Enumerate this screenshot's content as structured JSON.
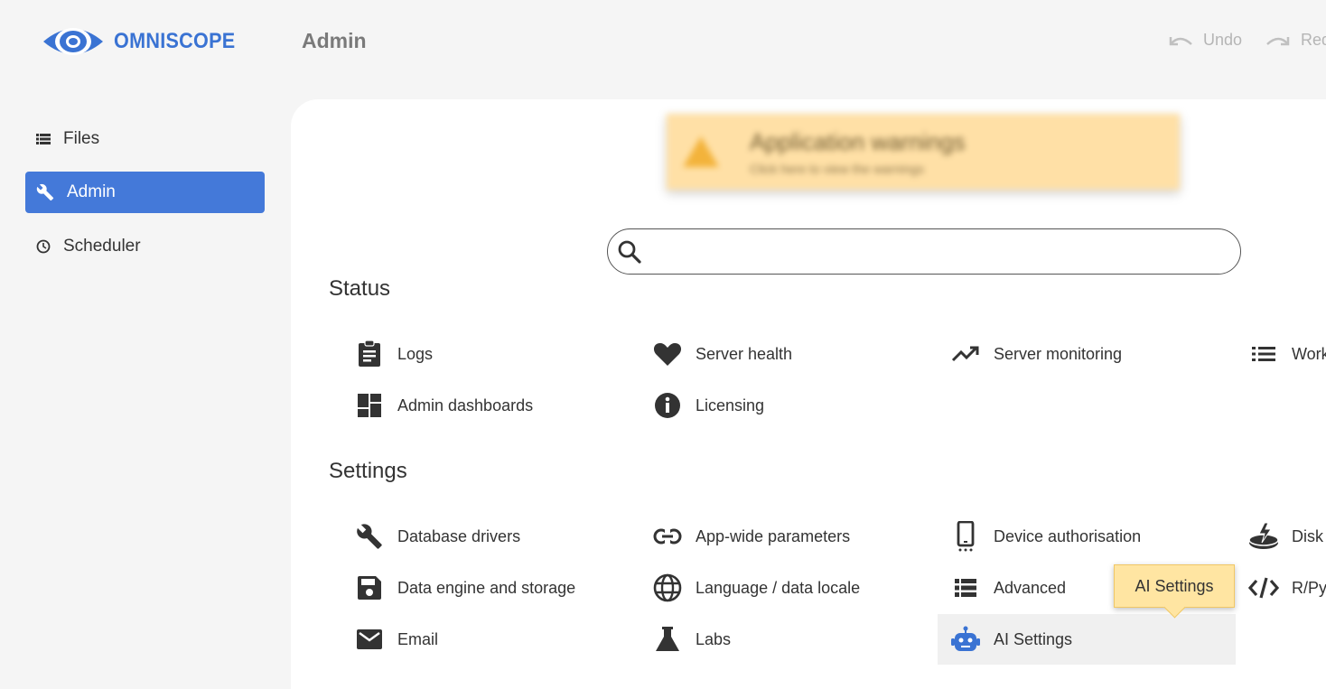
{
  "app": {
    "logo_text": "OMNISCOPE",
    "page_title": "Admin",
    "brand_color": "#3a73d3"
  },
  "history": {
    "undo_label": "Undo",
    "redo_label": "Redo"
  },
  "sidebar": {
    "items": [
      {
        "label": "Files",
        "icon": "list-icon"
      },
      {
        "label": "Admin",
        "icon": "wrench-icon",
        "active": true
      },
      {
        "label": "Scheduler",
        "icon": "clock-icon"
      }
    ]
  },
  "warning": {
    "title": "Application warnings",
    "subtitle": "Click here to view the warnings"
  },
  "search": {
    "placeholder": ""
  },
  "status": {
    "title": "Status",
    "items": [
      {
        "label": "Logs",
        "icon": "clipboard-icon"
      },
      {
        "label": "Server health",
        "icon": "heart-icon"
      },
      {
        "label": "Server monitoring",
        "icon": "trending-up-icon"
      },
      {
        "label": "Work",
        "icon": "list-lines-icon"
      },
      {
        "label": "Admin dashboards",
        "icon": "dashboard-icon"
      },
      {
        "label": "Licensing",
        "icon": "info-icon"
      }
    ]
  },
  "settings": {
    "title": "Settings",
    "items": [
      {
        "label": "Database drivers",
        "icon": "wrench-icon"
      },
      {
        "label": "App-wide parameters",
        "icon": "link-icon"
      },
      {
        "label": "Device authorisation",
        "icon": "phone-icon"
      },
      {
        "label": "Disk",
        "icon": "disk-icon"
      },
      {
        "label": "Data engine and storage",
        "icon": "save-icon"
      },
      {
        "label": "Language / data locale",
        "icon": "globe-icon"
      },
      {
        "label": "Advanced",
        "icon": "list-icon"
      },
      {
        "label": "R/Py",
        "icon": "code-icon"
      },
      {
        "label": "Email",
        "icon": "mail-icon"
      },
      {
        "label": "Labs",
        "icon": "flask-icon"
      },
      {
        "label": "AI Settings",
        "icon": "robot-icon"
      }
    ]
  },
  "tooltip": {
    "text": "AI Settings"
  }
}
